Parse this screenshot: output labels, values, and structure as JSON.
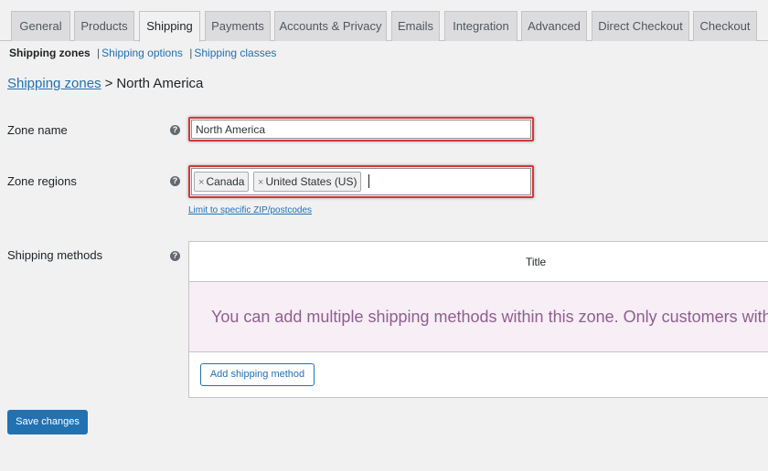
{
  "tabs": [
    {
      "label": "General"
    },
    {
      "label": "Products"
    },
    {
      "label": "Shipping"
    },
    {
      "label": "Payments"
    },
    {
      "label": "Accounts & Privacy"
    },
    {
      "label": "Emails"
    },
    {
      "label": "Integration"
    },
    {
      "label": "Advanced"
    },
    {
      "label": "Direct Checkout"
    },
    {
      "label": "Checkout"
    }
  ],
  "active_tab": "Shipping",
  "subnav": {
    "current": "Shipping zones",
    "links": [
      "Shipping options",
      "Shipping classes"
    ],
    "separator": "|"
  },
  "breadcrumb": {
    "link": "Shipping zones",
    "separator": ">",
    "current": "North America"
  },
  "zone_name": {
    "label": "Zone name",
    "value": "North America"
  },
  "zone_regions": {
    "label": "Zone regions",
    "chips": [
      "Canada",
      "United States (US)"
    ],
    "remove_glyph": "×",
    "limit_link": "Limit to specific ZIP/postcodes"
  },
  "shipping_methods": {
    "label": "Shipping methods",
    "column_title": "Title",
    "blank_text": "You can add multiple shipping methods within this zone. Only customers within the zone will see them.",
    "add_button": "Add shipping method"
  },
  "help_glyph": "?",
  "save_button": "Save changes",
  "colors": {
    "accent": "#2271b1",
    "highlight": "#d63638",
    "blank_bg": "#f7eef6",
    "blank_text": "#8f5f8f"
  },
  "icons": [
    "help-icon",
    "remove-icon"
  ]
}
